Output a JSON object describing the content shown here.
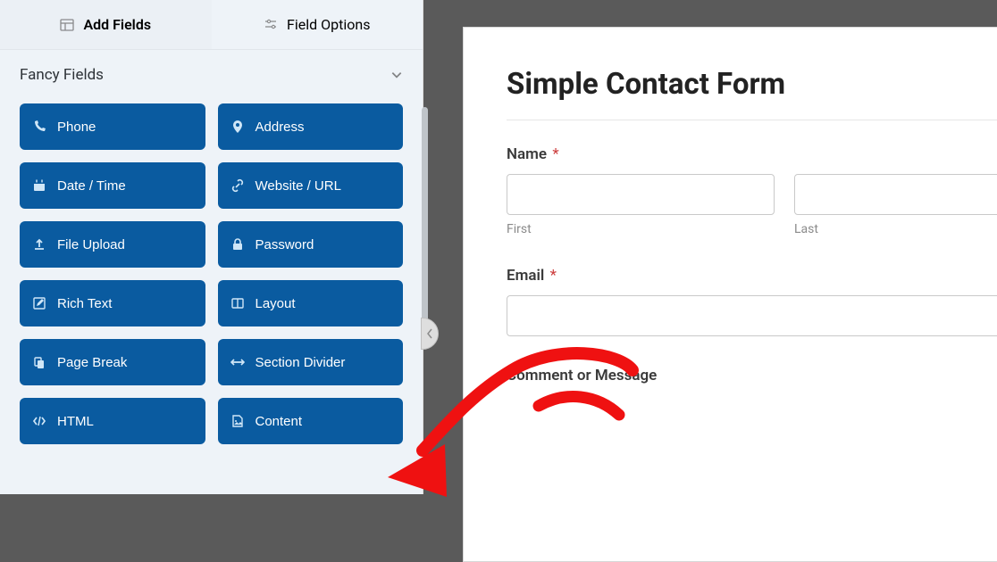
{
  "sidebar": {
    "tabs": [
      {
        "label": "Add Fields",
        "active": true
      },
      {
        "label": "Field Options",
        "active": false
      }
    ],
    "section_title": "Fancy Fields",
    "fields": [
      {
        "icon": "phone-icon",
        "label": "Phone"
      },
      {
        "icon": "map-marker-icon",
        "label": "Address"
      },
      {
        "icon": "calendar-icon",
        "label": "Date / Time"
      },
      {
        "icon": "link-icon",
        "label": "Website / URL"
      },
      {
        "icon": "upload-icon",
        "label": "File Upload"
      },
      {
        "icon": "lock-icon",
        "label": "Password"
      },
      {
        "icon": "pencil-square-icon",
        "label": "Rich Text"
      },
      {
        "icon": "columns-icon",
        "label": "Layout"
      },
      {
        "icon": "copy-icon",
        "label": "Page Break"
      },
      {
        "icon": "arrows-h-icon",
        "label": "Section Divider"
      },
      {
        "icon": "code-icon",
        "label": "HTML"
      },
      {
        "icon": "file-image-icon",
        "label": "Content"
      }
    ]
  },
  "form": {
    "title": "Simple Contact Form",
    "required_marker": "*",
    "fields": [
      {
        "label": "Name",
        "required": true,
        "type": "name",
        "sublabels": {
          "first": "First",
          "last": "Last"
        },
        "values": {
          "first": "",
          "last": ""
        }
      },
      {
        "label": "Email",
        "required": true,
        "type": "email",
        "value": ""
      },
      {
        "label": "Comment or Message",
        "required": false,
        "type": "textarea",
        "value": ""
      }
    ]
  }
}
